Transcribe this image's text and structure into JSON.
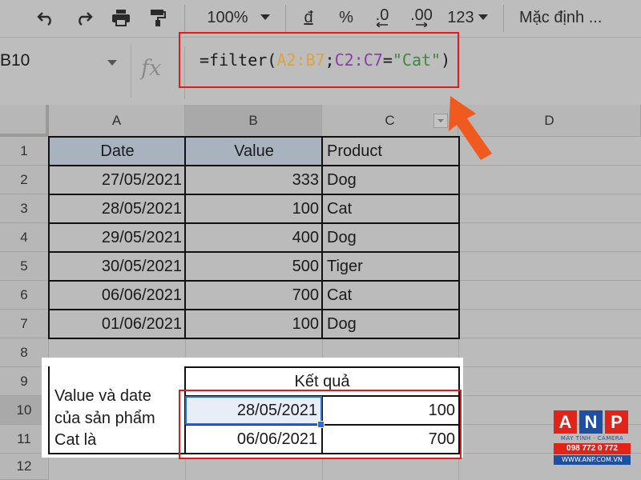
{
  "toolbar": {
    "zoom": "100%",
    "currency": "đ",
    "percent": "%",
    "decrease_decimal": ".0",
    "increase_decimal": ".00",
    "number_format": "123",
    "font": "Mặc định ..."
  },
  "formula_bar": {
    "name_box": "B10",
    "fx": "fx",
    "formula_parts": [
      "=filter(",
      "A2:B7",
      ";",
      "C2:C7",
      "=",
      "\"Cat\"",
      ")"
    ]
  },
  "columns": [
    "A",
    "B",
    "C",
    "D"
  ],
  "rows": [
    "1",
    "2",
    "3",
    "4",
    "5",
    "6",
    "7",
    "8",
    "9",
    "10",
    "11",
    "12"
  ],
  "table": {
    "headers": [
      "Date",
      "Value",
      "Product"
    ],
    "rows": [
      [
        "27/05/2021",
        "333",
        "Dog"
      ],
      [
        "28/05/2021",
        "100",
        "Cat"
      ],
      [
        "29/05/2021",
        "400",
        "Dog"
      ],
      [
        "30/05/2021",
        "500",
        "Tiger"
      ],
      [
        "06/06/2021",
        "700",
        "Cat"
      ],
      [
        "01/06/2021",
        "100",
        "Dog"
      ]
    ]
  },
  "result": {
    "header": "Kết quả",
    "label_lines": [
      "Value và date",
      "của sản phẩm",
      "Cat là"
    ],
    "rows": [
      [
        "28/05/2021",
        "100"
      ],
      [
        "06/06/2021",
        "700"
      ]
    ]
  },
  "logo": {
    "letters": [
      "A",
      "N",
      "P"
    ],
    "subtitle": "MÁY TÍNH · CAMERA",
    "phone": "098 772 0 772",
    "website": "WWW.ANP.COM.VN"
  },
  "colors": {
    "highlight_red": "#e01b1b",
    "selection_blue": "#1a73e8",
    "arrow_orange": "#f05a1e",
    "header_fill": "#a9b3c0"
  }
}
